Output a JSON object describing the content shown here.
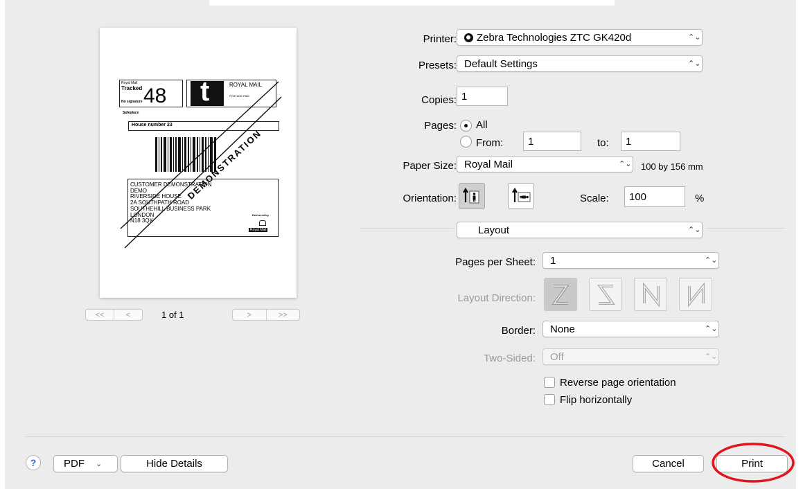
{
  "preview": {
    "page_indicator": "1 of 1",
    "nav_first": "<<",
    "nav_prev": "<",
    "nav_next": ">",
    "nav_last": ">>",
    "label": {
      "service_small": "Royal Mail",
      "service": "Tracked",
      "service_number": "48",
      "no_signature": "No signature",
      "safeplace_title": "Safeplace",
      "safeplace_value": "House number 23",
      "brand_letter": "t",
      "brand_name": "ROYAL MAIL",
      "postage_small": "POSTAGE PAID",
      "watermark": "DEMONSTRATION",
      "address_lines": [
        "CUSTOMER DEMONSTRATION",
        "DEMO",
        "RIVERSIDE HOUSE",
        "2A SOUTHPATH ROAD",
        "SOUTHEHILL BUSINESS PARK",
        "LONDON",
        "N18 3QX"
      ],
      "delivered_by": "Delivered by",
      "royal_mail_badge": "Royal Mail"
    }
  },
  "printer": {
    "label": "Printer:",
    "value": "Zebra Technologies ZTC GK420d"
  },
  "presets": {
    "label": "Presets:",
    "value": "Default Settings"
  },
  "copies": {
    "label": "Copies:",
    "value": "1"
  },
  "pages": {
    "label": "Pages:",
    "all_label": "All",
    "from_label": "From:",
    "from_value": "1",
    "to_label": "to:",
    "to_value": "1",
    "selected": "All"
  },
  "paper_size": {
    "label": "Paper Size:",
    "value": "Royal Mail",
    "dimensions": "100 by 156 mm"
  },
  "orientation": {
    "label": "Orientation:",
    "selected": "portrait"
  },
  "scale": {
    "label": "Scale:",
    "value": "100",
    "unit": "%"
  },
  "section": {
    "value": "Layout"
  },
  "pages_per_sheet": {
    "label": "Pages per Sheet:",
    "value": "1"
  },
  "layout_direction": {
    "label": "Layout Direction:"
  },
  "border": {
    "label": "Border:",
    "value": "None"
  },
  "two_sided": {
    "label": "Two-Sided:",
    "value": "Off"
  },
  "reverse_orientation": {
    "label": "Reverse page orientation",
    "checked": false
  },
  "flip_horizontally": {
    "label": "Flip horizontally",
    "checked": false
  },
  "footer": {
    "help": "?",
    "pdf": "PDF",
    "hide_details": "Hide Details",
    "cancel": "Cancel",
    "print": "Print"
  },
  "colors": {
    "annotation_circle": "#e0161c",
    "help_icon": "#2a6fd6"
  }
}
